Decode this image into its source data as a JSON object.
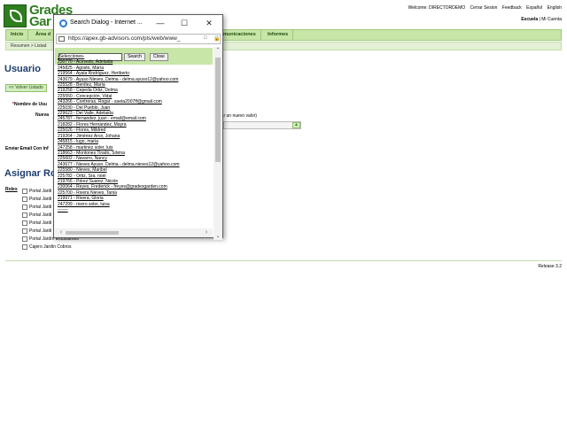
{
  "app": {
    "logo_text_1": "Grades",
    "logo_text_2": "Gar",
    "welcome": "Welcome: DIRECTORDEMO",
    "links": [
      "Cerrar Sesion",
      "Feedback",
      "Español",
      "English"
    ],
    "school": "Escuela",
    "account": "Mi Cuenta"
  },
  "nav": {
    "items": [
      "Inicio",
      "Área d",
      "municaciones",
      "Informes"
    ],
    "sub": "Resumen  >  Listad"
  },
  "page": {
    "title": "Usuario",
    "back": "<< Volver Listado",
    "user_name_label": "Nombre de Usu",
    "new_label": "Nueva",
    "assign_note": "ignar un nuevo valor)",
    "send_email": "Enviar Email Con Inf",
    "combo_btn": "▲",
    "assign_title": "Asignar Rol",
    "roles_label": "Roles",
    "roles": [
      "Portal Jardi",
      "Portal Jardi",
      "Portal Jardi",
      "Portal Jardi",
      "Portal Jardi",
      "Portal Jardi",
      "Portal Jardín Estudiantes",
      "Cajero Jardín Cobros"
    ],
    "release": "Release 3.2"
  },
  "dialog": {
    "title": "Search Dialog - Internet ...",
    "url": "https://apex.gb-advisors.com/pls/web/www_",
    "search_value": "",
    "search_btn": "Search",
    "close_btn": "Close",
    "results": [
      "-Selecciones-",
      "230770 - Acevedo, Adelaida",
      "245825 - Agosto, María",
      "219564 - Ayala Rodríguez, Heriberto",
      "243679 - Ayuso Nieves, Delma - delma.ayuso12@yahoo.com",
      "225528 - Benítez, María",
      "219258 - Cepeda Ortiz, Delma",
      "225550 - Concepción, Vidal",
      "243266 - Contreras, Rogar - saeta2007ff@gmail.com",
      "225030 - Del Pueblo, Juan",
      "229623 - Del Valle, Adelaida",
      "245787 - fernandez, juan - email@email.com",
      "218282 - Flores Hernández, Mayra",
      "225026 - Flores, Mildred",
      "219264 - Jiménez Arce, Johana",
      "245815 - lugo, maria",
      "247258 - martinez soler, luis",
      "218663 - Montones Tirado, Silvina",
      "225602 - Navarro, Nancy",
      "243677 - Nieves Ayuso, Delma - delma.nieves12@yahoo.com",
      "225580 - Nieves, Maribel",
      "225782 - Ortiz, Sra. noel",
      "219766 - Pérez Suarez, Nicole",
      "230064 - Reyes, Frederick - freyes@gradesgarden.com",
      "225700 - Rivera Nieves, Tania",
      "219971 - Rivera, Gloria",
      "247299 - rivero soler, luisa",
      "-------"
    ]
  }
}
